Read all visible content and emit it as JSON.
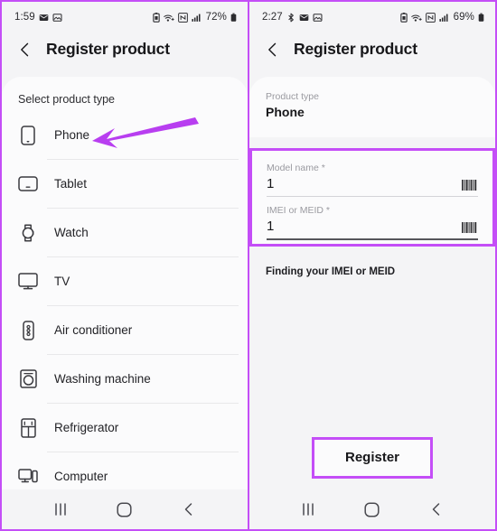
{
  "left_phone": {
    "status_bar": {
      "time": "1:59",
      "icons": [
        "mail-icon",
        "gallery-icon"
      ],
      "right_icons": [
        "battery-saver-icon",
        "wifi-calling-icon",
        "nfc-icon",
        "signal-icon"
      ],
      "battery": "72%"
    },
    "app_bar": {
      "back_icon": "back-chevron-icon",
      "title": "Register product"
    },
    "section_title": "Select product type",
    "product_types": [
      {
        "label": "Phone",
        "icon": "phone-icon"
      },
      {
        "label": "Tablet",
        "icon": "tablet-icon"
      },
      {
        "label": "Watch",
        "icon": "watch-icon"
      },
      {
        "label": "TV",
        "icon": "tv-icon"
      },
      {
        "label": "Air conditioner",
        "icon": "air-conditioner-icon"
      },
      {
        "label": "Washing machine",
        "icon": "washing-machine-icon"
      },
      {
        "label": "Refrigerator",
        "icon": "refrigerator-icon"
      },
      {
        "label": "Computer",
        "icon": "computer-icon"
      }
    ],
    "annotation": {
      "type": "arrow",
      "points_to": "Phone",
      "color": "#b83ef0"
    },
    "nav_bar": [
      "recents-icon",
      "home-icon",
      "back-icon"
    ]
  },
  "right_phone": {
    "status_bar": {
      "time": "2:27",
      "icons": [
        "bluetooth-icon",
        "mail-icon",
        "gallery-icon"
      ],
      "right_icons": [
        "battery-saver-icon",
        "wifi-calling-icon",
        "nfc-icon",
        "signal-icon"
      ],
      "battery": "69%"
    },
    "app_bar": {
      "back_icon": "back-chevron-icon",
      "title": "Register product"
    },
    "product_type": {
      "caption": "Product type",
      "value": "Phone"
    },
    "fields": [
      {
        "caption": "Model name *",
        "value": "1",
        "placeholder": "Model name",
        "trailing_icon": "barcode-icon",
        "highlighted": true
      },
      {
        "caption": "IMEI or MEID *",
        "value": "1",
        "placeholder": "IMEI or MEID",
        "trailing_icon": "barcode-icon",
        "highlighted": true
      }
    ],
    "help_link": "Finding your IMEI or MEID",
    "submit": {
      "label": "Register",
      "highlighted": true
    },
    "nav_bar": [
      "recents-icon",
      "home-icon",
      "back-icon"
    ]
  },
  "colors": {
    "annotation_purple": "#c44ef7",
    "arrow_purple": "#b83ef0",
    "page_bg": "#f4f4f6",
    "card_bg": "#fbfbfc",
    "text_primary": "#17171a",
    "text_muted": "#9a9aa0"
  }
}
